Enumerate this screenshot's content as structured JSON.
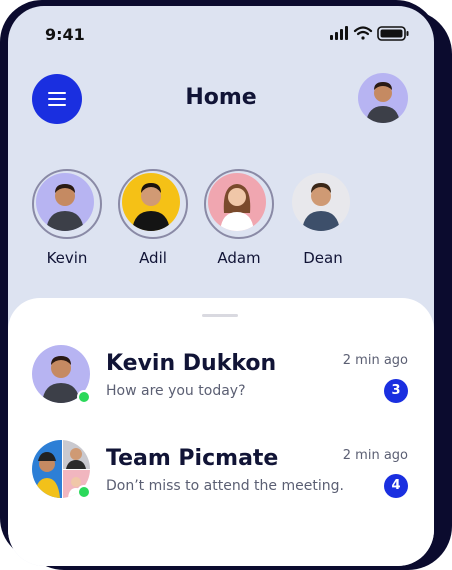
{
  "status_bar": {
    "time": "9:41",
    "icons": [
      "signal-icon",
      "wifi-icon",
      "battery-icon"
    ]
  },
  "header": {
    "title": "Home",
    "menu_icon": "hamburger-menu-icon",
    "profile_icon": "user-avatar"
  },
  "stories": [
    {
      "name": "Kevin",
      "bg": "#b7b4f2"
    },
    {
      "name": "Adil",
      "bg": "#f5c116"
    },
    {
      "name": "Adam",
      "bg": "#f0a6b0"
    },
    {
      "name": "Dean",
      "bg": "#e8e8ec"
    }
  ],
  "chats": [
    {
      "name": "Kevin Dukkon",
      "message": "How are you today?",
      "time": "2 min ago",
      "unread": "3"
    },
    {
      "name": "Team Picmate",
      "message": "Don’t miss to attend the meeting.",
      "time": "2 min ago",
      "unread": "4"
    }
  ],
  "colors": {
    "accent": "#1a2fe0",
    "background": "#dde3f1",
    "online": "#2bd85a",
    "dark": "#111436"
  }
}
